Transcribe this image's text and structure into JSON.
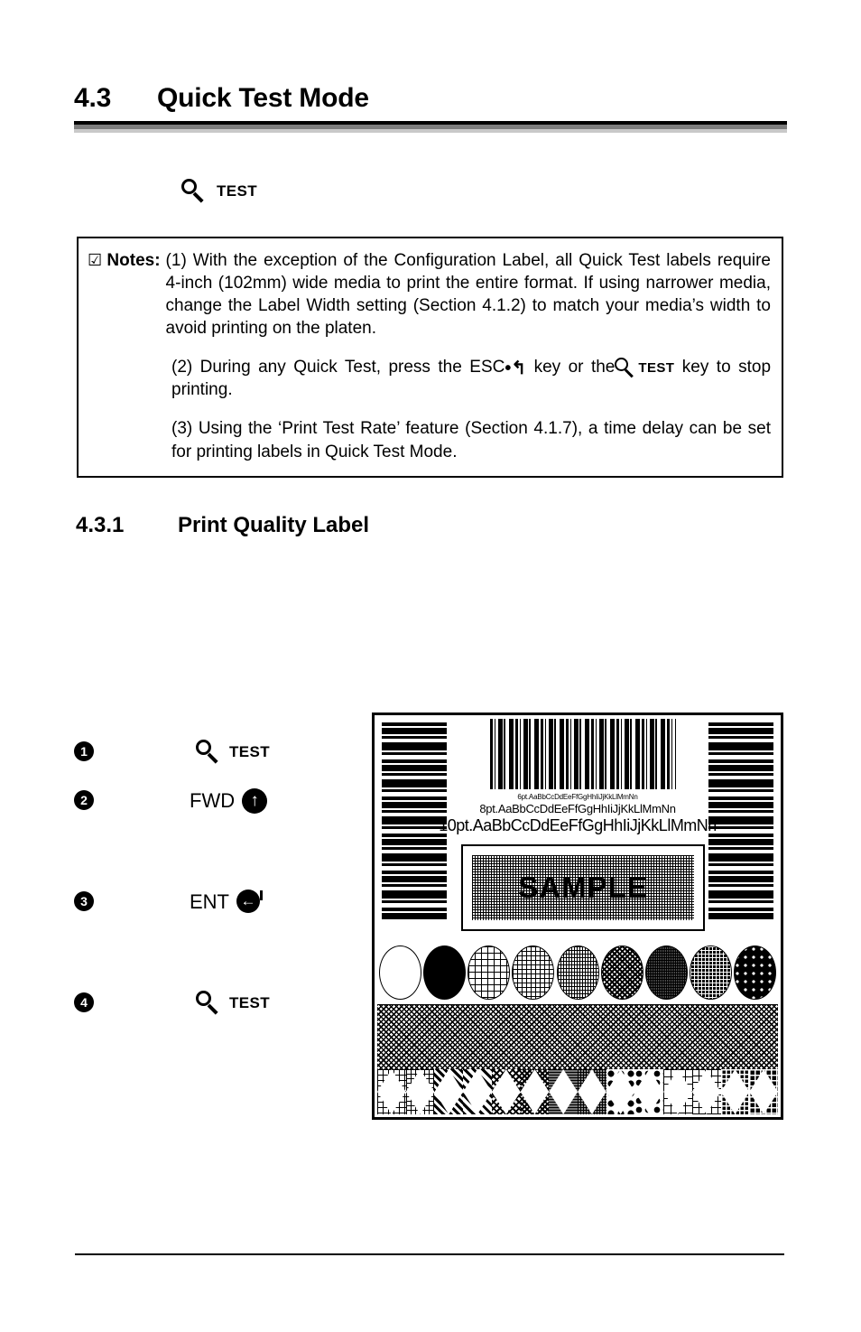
{
  "section": {
    "number": "4.3",
    "title": "Quick Test Mode"
  },
  "test_callout": {
    "icon": "magnifier-icon",
    "label": "TEST"
  },
  "notes": {
    "checkbox_glyph": "☑",
    "label": "Notes:",
    "items": [
      "(1) With the exception of the Configuration Label, all Quick Test labels require 4-inch (102mm) wide media to print the entire format. If using narrower media, change the Label Width setting (Section 4.1.2) to match your media’s width to avoid printing on the platen.",
      {
        "part_a": "(2) During any Quick Test, press the",
        "esc_label": "ESC",
        "esc_glyph": "•↰",
        "part_b": "key or the",
        "test_label": "TEST",
        "part_c": "key to stop printing."
      },
      "(3) Using the ‘Print Test Rate’ feature (Section 4.1.7), a time delay can be set for printing labels in Quick Test Mode."
    ]
  },
  "subsection": {
    "number": "4.3.1",
    "title": "Print Quality Label"
  },
  "steps": [
    {
      "bullet": "1",
      "key_text": "",
      "key_bold": "TEST",
      "icon": "magnifier-icon"
    },
    {
      "bullet": "2",
      "key_text": "FWD",
      "key_bold": "",
      "icon": "circled-up-arrow-icon",
      "glyph": "↑"
    },
    {
      "bullet": "3",
      "key_text": "ENT",
      "key_bold": "",
      "icon": "circled-enter-arrow-icon",
      "glyph": "←"
    },
    {
      "bullet": "4",
      "key_text": "",
      "key_bold": "TEST",
      "icon": "magnifier-icon"
    }
  ],
  "sample_label": {
    "font_lines": [
      "6pt.AaBbCcDdEeFfGgHhIiJjKkLlMmNn",
      "8pt.AaBbCcDdEeFfGgHhIiJjKkLlMmNn",
      "10pt.AaBbCcDdEeFfGgHhIiJjKkLlMmNn"
    ],
    "sample_word": "SAMPLE",
    "circle_count": 9,
    "diamond_count": 14
  },
  "colors": {
    "text": "#000000",
    "rule_dark": "#000000",
    "rule_gray": "#7d7d7d",
    "rule_light": "#c9c9c9",
    "page_background": "#ffffff"
  }
}
